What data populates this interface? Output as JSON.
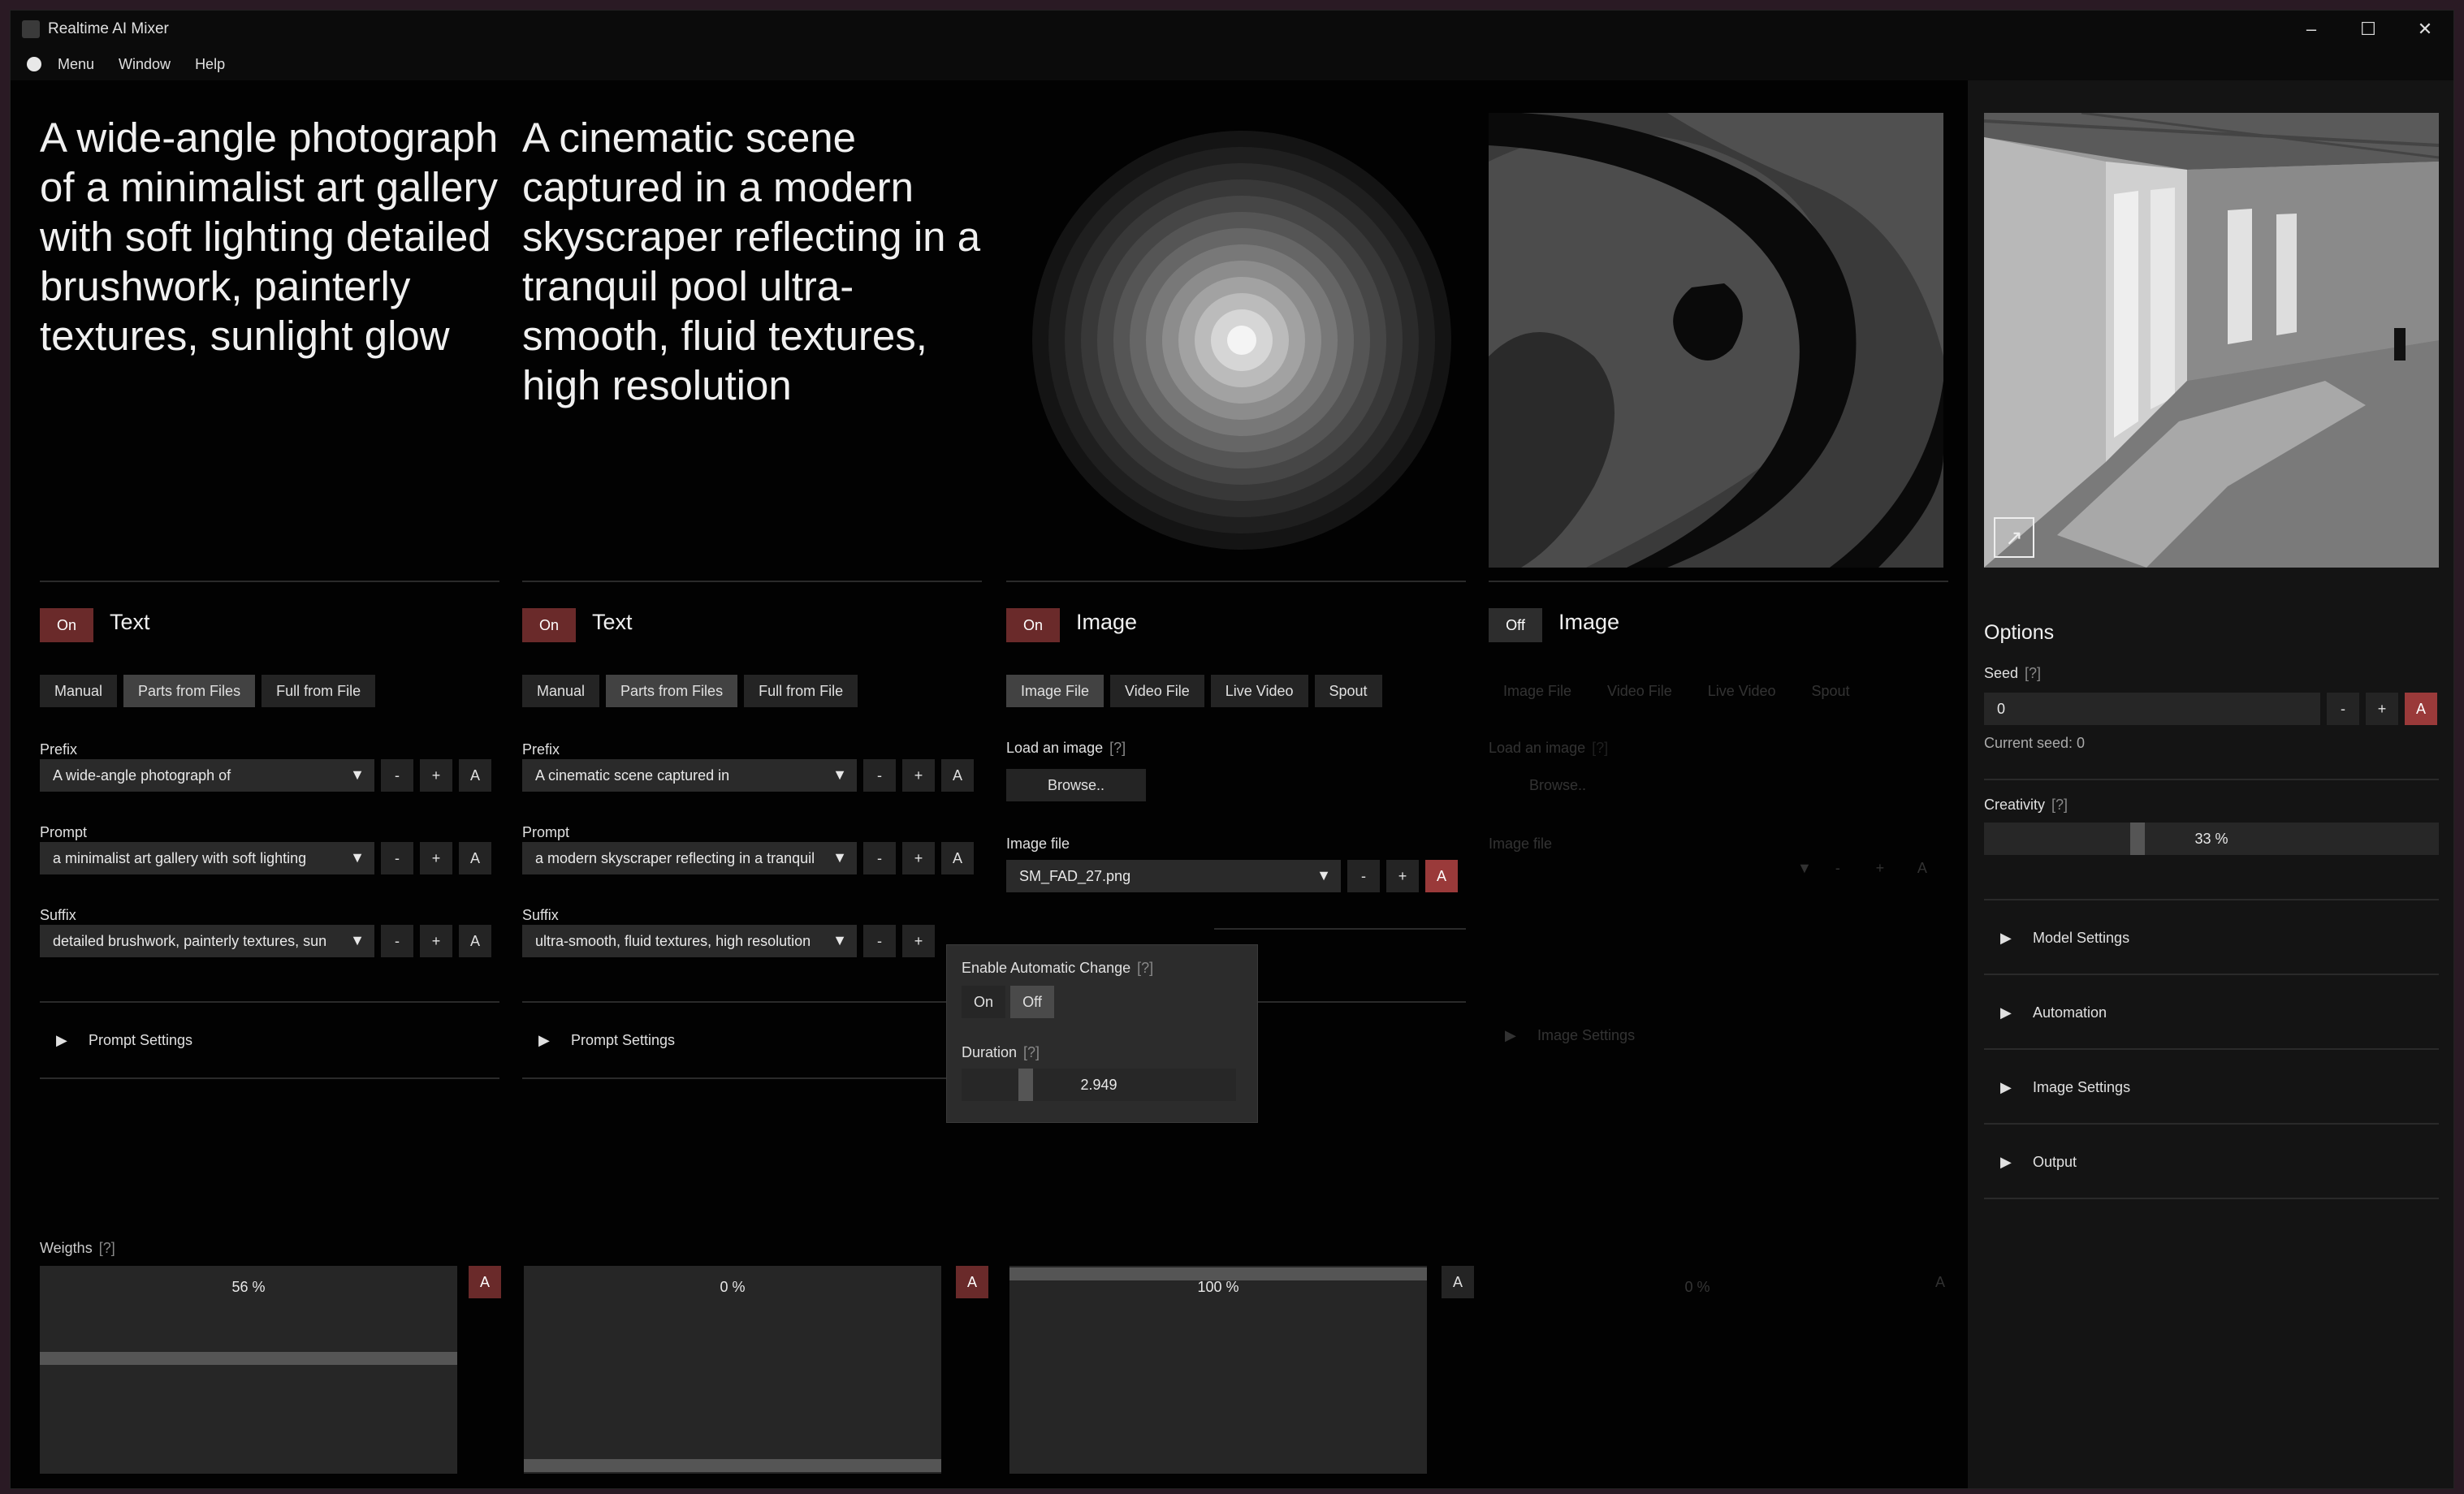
{
  "window": {
    "title": "Realtime AI Mixer",
    "controls": [
      "–",
      "☐",
      "✕"
    ]
  },
  "menu": [
    "Menu",
    "Window",
    "Help"
  ],
  "columns": [
    {
      "prompt_display": "A wide-angle photograph of a minimalist art gallery with soft lighting detailed brushwork, painterly textures, sunlight glow",
      "toggle": "On",
      "type": "Text",
      "tabs": [
        "Manual",
        "Parts from Files",
        "Full from File"
      ],
      "prefix_label": "Prefix",
      "prefix_value": "A wide-angle photograph of",
      "prompt_label": "Prompt",
      "prompt_value": "a minimalist art gallery with soft lighting",
      "suffix_label": "Suffix",
      "suffix_value": "detailed brushwork, painterly textures, sun",
      "settings_label": "Prompt Settings",
      "weight": "56 %",
      "weight_fraction": 0.56
    },
    {
      "prompt_display": "A cinematic scene captured in a modern skyscraper reflecting in a tranquil pool ultra-smooth, fluid textures, high resolution",
      "toggle": "On",
      "type": "Text",
      "tabs": [
        "Manual",
        "Parts from Files",
        "Full from File"
      ],
      "prefix_label": "Prefix",
      "prefix_value": "A cinematic scene captured in",
      "prompt_label": "Prompt",
      "prompt_value": "a modern skyscraper reflecting in a tranquil",
      "suffix_label": "Suffix",
      "suffix_value": "ultra-smooth, fluid textures, high resolution",
      "settings_label": "Prompt Settings",
      "weight": "0 %",
      "weight_fraction": 0.0
    },
    {
      "toggle": "On",
      "type": "Image",
      "tabs": [
        "Image File",
        "Video File",
        "Live Video",
        "Spout"
      ],
      "load_label": "Load an image",
      "browse": "Browse..",
      "file_label": "Image file",
      "file_value": "SM_FAD_27.png",
      "weight": "100 %",
      "weight_fraction": 1.0
    },
    {
      "toggle": "Off",
      "type": "Image",
      "tabs": [
        "Image File",
        "Video File",
        "Live Video",
        "Spout"
      ],
      "load_label": "Load an image",
      "browse": "Browse..",
      "file_label": "Image file",
      "settings_label": "Image Settings",
      "weight": "0 %"
    }
  ],
  "popup": {
    "title": "Enable Automatic Change",
    "help": "[?]",
    "on": "On",
    "off": "Off",
    "duration_label": "Duration",
    "duration_value": "2.949"
  },
  "weights": {
    "label": "Weigths",
    "help": "[?]"
  },
  "buttons": {
    "minus": "-",
    "plus": "+",
    "auto": "A",
    "help": "[?]"
  },
  "options": {
    "title": "Options",
    "seed_label": "Seed",
    "seed_value": "0",
    "current_seed": "Current seed: 0",
    "creativity_label": "Creativity",
    "creativity_value": "33 %",
    "creativity_fraction": 0.33,
    "sections": [
      "Model Settings",
      "Automation",
      "Image Settings",
      "Output"
    ]
  }
}
